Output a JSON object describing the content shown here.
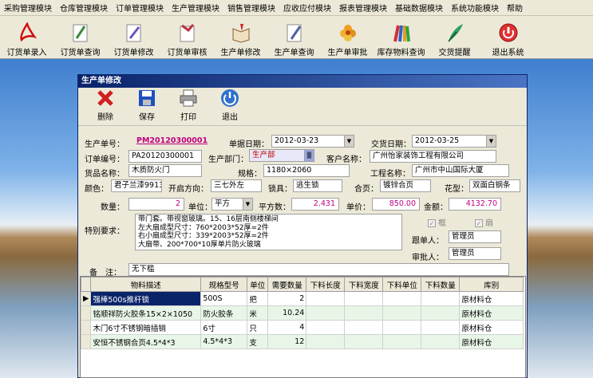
{
  "menu": [
    "采购管理模块",
    "仓库管理模块",
    "订单管理模块",
    "生产管理模块",
    "销售管理模块",
    "应收应付模块",
    "报表管理模块",
    "基础数据模块",
    "系统功能模块",
    "帮助"
  ],
  "toolbar": [
    {
      "label": "订货单录入",
      "icon": "pdf-icon"
    },
    {
      "label": "订货单查询",
      "icon": "feather-doc-icon"
    },
    {
      "label": "订货单修改",
      "icon": "edit-doc-icon"
    },
    {
      "label": "订货单审核",
      "icon": "bird-doc-icon"
    },
    {
      "label": "生产单修改",
      "icon": "book-icon"
    },
    {
      "label": "生产单查询",
      "icon": "pencil-doc-icon"
    },
    {
      "label": "生产单审批",
      "icon": "flower-icon"
    },
    {
      "label": "库存物料查询",
      "icon": "crayons-icon"
    },
    {
      "label": "交货提醒",
      "icon": "quill-icon"
    },
    {
      "label": "退出系统",
      "icon": "exit-icon"
    }
  ],
  "window": {
    "title": "生产单修改",
    "tools": [
      "删除",
      "保存",
      "打印",
      "退出"
    ]
  },
  "form": {
    "l_order_no": "生产单号：",
    "order_no": "PM20120300001",
    "l_doc_date": "单据日期：",
    "doc_date": "2012-03-23",
    "l_delivery_date": "交货日期：",
    "delivery_date": "2012-03-25",
    "l_po_no": "订单编号：",
    "po_no": "PA20120300001",
    "l_dept": "生产部门：",
    "dept": "生产部",
    "l_customer": "客户名称：",
    "customer": "广州怡家装饰工程有限公司",
    "l_goods": "货品名称：",
    "goods": "木质防火门",
    "l_spec": "规格：",
    "spec": "1180×2060",
    "l_project": "工程名称：",
    "project": "广州市中山国际大厦",
    "l_color": "颜色：",
    "color": "君子兰漆9913",
    "l_open_dir": "开启方向：",
    "open_dir": "三七外左",
    "l_lock": "锁具：",
    "lock": "逃生锁",
    "l_hinge": "合页：",
    "hinge": "镀锌合页",
    "l_pattern": "花型：",
    "pattern": "双面白钢条",
    "l_qty": "数量：",
    "qty": "2",
    "l_unit": "单位：",
    "unit": "平方",
    "l_sqm": "平方数：",
    "sqm": "2.431",
    "l_price": "单价：",
    "price": "850.00",
    "l_amount": "金额：",
    "amount": "4132.70",
    "l_special": "特别要求：",
    "special": "带门套。带视窗玻璃。15、16层南侧楼梯间\n左大扇成型尺寸：760*2003*52厚=2件\n右小扇成型尺寸：339*2003*52厚=2件\n大扇带、200*700*10厚单片防火玻璃",
    "frame": "框",
    "fan": "扇",
    "l_follower": "跟单人：",
    "follower": "管理员",
    "l_approver": "审批人：",
    "approver": "管理员",
    "l_remark": "备　注：",
    "remark": "无下槛"
  },
  "table": {
    "headers": [
      "物料描述",
      "规格型号",
      "单位",
      "需要数量",
      "下料长度",
      "下料宽度",
      "下料单位",
      "下料数量",
      "库别"
    ],
    "rows": [
      [
        "强棒500s推杆锁",
        "500S",
        "把",
        "2",
        "",
        "",
        "",
        "",
        "原材料仓"
      ],
      [
        "铭顺祥防火胶条15×2×1050",
        "防火胶条",
        "米",
        "10.24",
        "",
        "",
        "",
        "",
        "原材料仓"
      ],
      [
        "木门6寸不锈钢暗插销",
        "6寸",
        "只",
        "4",
        "",
        "",
        "",
        "",
        "原材料仓"
      ],
      [
        "安恒不锈钢合页4.5*4*3",
        "4.5*4*3",
        "支",
        "12",
        "",
        "",
        "",
        "",
        "原材料仓"
      ]
    ]
  }
}
